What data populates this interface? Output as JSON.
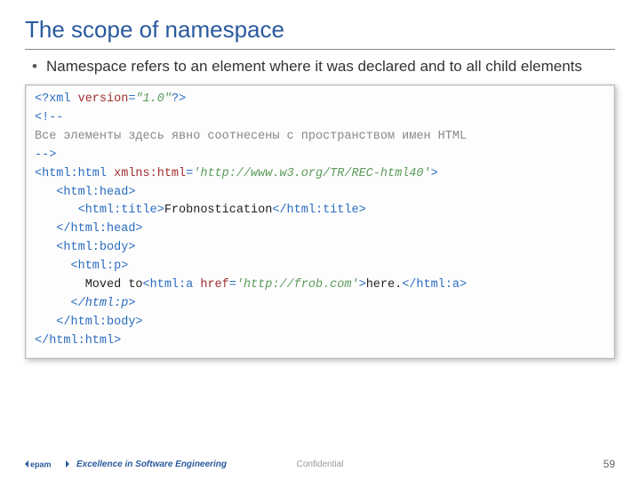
{
  "title": "The scope of namespace",
  "bullets": [
    "Namespace refers to an element where it was declared and to all child elements"
  ],
  "code": {
    "l1a": "<?xml ",
    "l1b": "version",
    "l1c": "=",
    "l1d": "\"1.0\"",
    "l1e": "?>",
    "l2a": "<!--",
    "l3a": "Все элементы здесь явно соотнесены с пространством имен HTML",
    "l4a": "-->",
    "l5a": "<html:html ",
    "l5b": "xmlns:html",
    "l5c": "=",
    "l5d": "'http://www.w3.org/TR/REC-html40'",
    "l5e": ">",
    "l6a": "   <html:head>",
    "l7a": "      <html:title>",
    "l7b": "Frobnostication",
    "l7c": "</html:title>",
    "l8a": "   </html:head>",
    "l9a": "   <html:body>",
    "l10a": "     <html:p>",
    "l11a": "       Moved to",
    "l11b": "<html:a ",
    "l11c": "href",
    "l11d": "=",
    "l11e": "'http://frob.com'",
    "l11f": ">",
    "l11g": "here.",
    "l11h": "</html:a>",
    "l12a": "     </html:p>",
    "l13a": "   </html:body>",
    "l14a": "</html:html>"
  },
  "footer": {
    "tagline": "Excellence in Software Engineering",
    "confidential": "Confidential",
    "page": "59",
    "logo_text": "epam"
  }
}
